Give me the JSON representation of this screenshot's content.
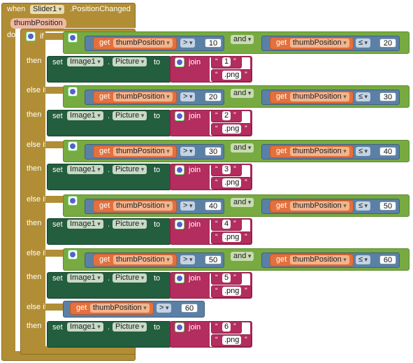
{
  "event": {
    "when": "when",
    "component": "Slider1",
    "event": ".PositionChanged",
    "param": "thumbPosition",
    "do": "do"
  },
  "kw": {
    "if": "if",
    "then": "then",
    "elseif": "else if",
    "and": "and",
    "get": "get",
    "set": "set",
    "dot": ".",
    "to": "to",
    "join": "join",
    "q": "“",
    "q2": "”"
  },
  "branches": [
    {
      "label": "if",
      "var": "thumbPosition",
      "op1": ">",
      "n1": "10",
      "op2": "≤",
      "n2": "20",
      "img": "1",
      "ext": ".png"
    },
    {
      "label": "else if",
      "var": "thumbPosition",
      "op1": ">",
      "n1": "20",
      "op2": "≤",
      "n2": "30",
      "img": "2",
      "ext": ".png"
    },
    {
      "label": "else if",
      "var": "thumbPosition",
      "op1": ">",
      "n1": "30",
      "op2": "≤",
      "n2": "40",
      "img": "3",
      "ext": ".png"
    },
    {
      "label": "else if",
      "var": "thumbPosition",
      "op1": ">",
      "n1": "40",
      "op2": "≤",
      "n2": "50",
      "img": "4",
      "ext": ".png"
    },
    {
      "label": "else if",
      "var": "thumbPosition",
      "op1": ">",
      "n1": "50",
      "op2": "≤",
      "n2": "60",
      "img": "5",
      "ext": ".png"
    },
    {
      "label": "else if",
      "var": "thumbPosition",
      "op1": ">",
      "n1": "60",
      "img": "6",
      "ext": ".png"
    }
  ],
  "set": {
    "component": "Image1",
    "property": "Picture"
  }
}
